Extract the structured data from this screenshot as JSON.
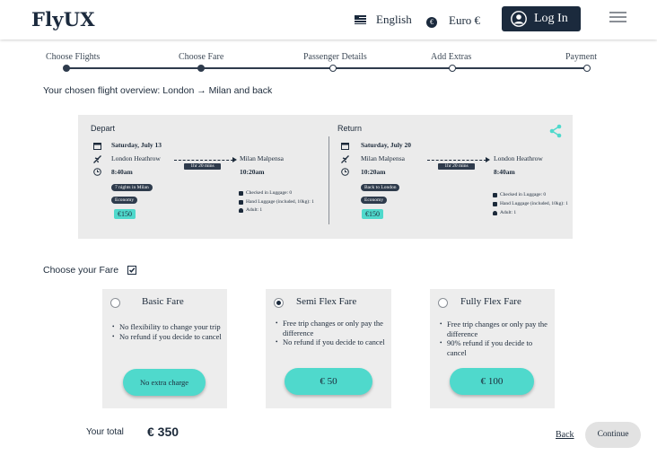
{
  "header": {
    "logo": "FlyUX",
    "language": "English",
    "currency": "Euro €",
    "currency_symbol": "€",
    "login_label": "Log In"
  },
  "progress": {
    "steps": [
      "Choose Flights",
      "Choose Fare",
      "Passenger Details",
      "Add Extras",
      "Payment"
    ],
    "completed": 2
  },
  "overview": {
    "title": "Your chosen flight overview: London → Milan and back",
    "depart": {
      "heading": "Depart",
      "date": "Saturday, July 13",
      "from": "London Heathrow",
      "to": "Milan Malpensa",
      "duration": "1hr 20 mins",
      "dep_time": "8:40am",
      "arr_time": "10:20am",
      "tag1": "7 nights in Milan",
      "tag2": "Economy",
      "price": "€150",
      "luggage": [
        "Checked in Luggage: 0",
        "Hand Luggage (included, 10kg): 1",
        "Adult: 1"
      ]
    },
    "return": {
      "heading": "Return",
      "date": "Saturday, July 20",
      "from": "Milan Malpensa",
      "to": "London Heathrow",
      "duration": "1hr 20 mins",
      "dep_time": "10:20am",
      "arr_time": "8:40am",
      "tag1": "Back to London",
      "tag2": "Economy",
      "price": "€150",
      "luggage": [
        "Checked in Luggage: 0",
        "Hand Luggage (included, 10kg): 1",
        "Adult: 1"
      ]
    }
  },
  "fares": {
    "label": "Choose your Fare",
    "checked": true,
    "options": [
      {
        "title": "Basic Fare",
        "features": [
          "No flexibility to change your trip",
          "No refund if you decide to cancel"
        ],
        "button": "No extra charge",
        "selected": false
      },
      {
        "title": "Semi Flex Fare",
        "features": [
          "Free trip changes or only pay the difference",
          "No refund if you decide to cancel"
        ],
        "button": "€ 50",
        "selected": true
      },
      {
        "title": "Fully Flex Fare",
        "features": [
          "Free trip changes or only pay the difference",
          "90% refund if you decide to cancel"
        ],
        "button": "€ 100",
        "selected": false
      }
    ]
  },
  "footer": {
    "total_label": "Your total",
    "total_value": "€ 350",
    "back_label": "Back",
    "continue_label": "Continue"
  },
  "colors": {
    "navy": "#1b2a3d",
    "teal": "#4fd9cc",
    "panel": "#ebebeb"
  }
}
